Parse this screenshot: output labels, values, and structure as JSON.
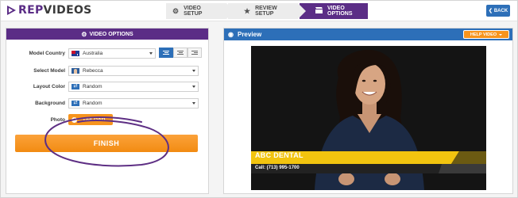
{
  "brand": {
    "name_part1": "REP",
    "name_part2": "VIDEOS",
    "accent": "#5b2d86"
  },
  "wizard": {
    "steps": [
      {
        "icon": "gears-icon",
        "label": "VIDEO SETUP",
        "active": false
      },
      {
        "icon": "star-icon",
        "label": "REVIEW SETUP",
        "active": false
      },
      {
        "icon": "clapperboard-icon",
        "label": "VIDEO OPTIONS",
        "active": true
      }
    ],
    "back_label": "BACK"
  },
  "options_panel": {
    "title": "VIDEO OPTIONS",
    "model_country": {
      "label": "Model Country",
      "value": "Australia"
    },
    "select_model": {
      "label": "Select Model",
      "value": "Rebecca"
    },
    "layout_color": {
      "label": "Layout Color",
      "value": "Random"
    },
    "background": {
      "label": "Background",
      "value": "Random"
    },
    "photo": {
      "label": "Photo",
      "button": "UPLOAD"
    },
    "alignment": {
      "options": [
        "left",
        "center",
        "right"
      ],
      "selected": "left"
    },
    "finish_label": "FINISH"
  },
  "preview_panel": {
    "title": "Preview",
    "help_label": "HELP VIDEO",
    "video": {
      "business_name": "ABC DENTAL",
      "phone": "Call: (713) 995-1700"
    }
  },
  "colors": {
    "primary_blue": "#2d6fb8",
    "orange": "#f7941d",
    "purple": "#5b2d86",
    "lower_third_yellow": "#f2c40f"
  }
}
